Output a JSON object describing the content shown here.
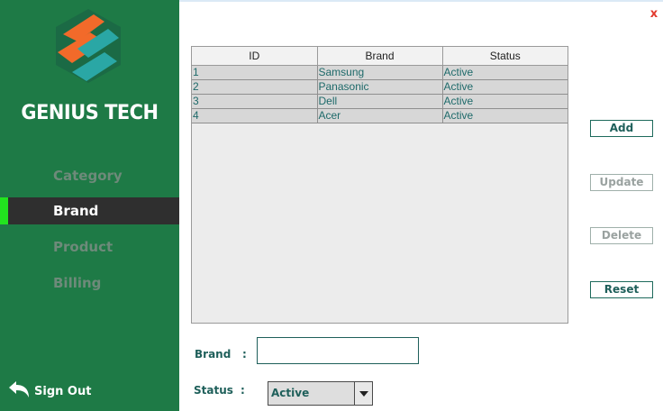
{
  "window": {
    "close_label": "x"
  },
  "sidebar": {
    "app_name": "GENIUS TECH",
    "logo_icon": "hexagon-swirl-logo",
    "items": [
      {
        "label": "Category",
        "active": false
      },
      {
        "label": "Brand",
        "active": true
      },
      {
        "label": "Product",
        "active": false
      },
      {
        "label": "Billing",
        "active": false
      }
    ],
    "signout_label": "Sign Out",
    "signout_icon": "undo-arrow-icon",
    "active_indicator_color": "#22e31f",
    "bg_color": "#1e7a46"
  },
  "table": {
    "headers": [
      "ID",
      "Brand",
      "Status"
    ],
    "rows": [
      [
        "1",
        "Samsung",
        "Active"
      ],
      [
        "2",
        "Panasonic",
        "Active"
      ],
      [
        "3",
        "Dell",
        "Active"
      ],
      [
        "4",
        "Acer",
        "Active"
      ]
    ]
  },
  "actions": {
    "add_label": "Add",
    "update_label": "Update",
    "delete_label": "Delete",
    "reset_label": "Reset"
  },
  "form": {
    "brand_label": "Brand",
    "brand_colon": ":",
    "brand_value": "",
    "status_label": "Status",
    "status_colon": ":",
    "status_selected": "Active"
  }
}
